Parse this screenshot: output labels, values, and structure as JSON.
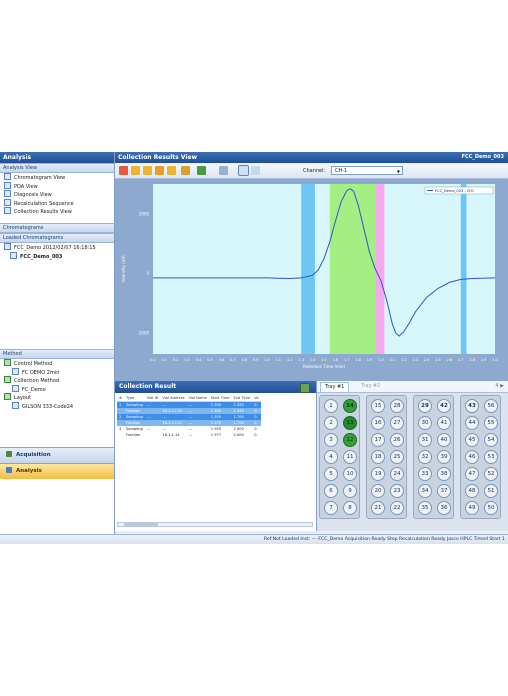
{
  "left_panel": {
    "title": "Analysis",
    "analysis_view": {
      "header": "Analysis View",
      "items": [
        "Chromatogram View",
        "PDA View",
        "Diagnosis View",
        "Recalculation Sequence",
        "Collection Results View"
      ]
    },
    "chromatograms": {
      "header": "Chromatograms"
    },
    "loaded": {
      "header": "Loaded Chromatograms",
      "items": [
        "FCC_Demo 2012/02/07 16:18:15",
        "FCC_Demo_003"
      ]
    },
    "method": {
      "header": "Method",
      "items": [
        "Control Method",
        "FC DEMO 2min",
        "Collection Method",
        "FC_Demo",
        "Layout",
        "GILSON 333-Code24"
      ]
    },
    "nav": {
      "acquisition": "Acquisition",
      "analysis": "Analysis"
    }
  },
  "main": {
    "title": "Collection Results View",
    "title_right": "FCC_Demo_003",
    "channel_label": "Channel:",
    "channel_value": "CH-1",
    "toolbar_icons": [
      "open-icon",
      "chart-icon",
      "chart-icon",
      "chart-icon",
      "chart-icon",
      "print-icon",
      "export-icon",
      "cursor-icon",
      "zoom-icon",
      "grid-icon"
    ]
  },
  "chart_data": {
    "type": "line",
    "xlabel": "Retention Time (min)",
    "ylabel": "Intensity (uV)",
    "x_ticks": [
      "0.0",
      "0.1",
      "0.2",
      "0.3",
      "0.4",
      "0.5",
      "0.6",
      "0.7",
      "0.8",
      "0.9",
      "1.0",
      "1.1",
      "1.2",
      "1.3",
      "1.4",
      "1.5",
      "1.6",
      "1.7",
      "1.8",
      "1.9",
      "2.0",
      "2.1",
      "2.2",
      "2.3",
      "2.4",
      "2.5",
      "2.6",
      "2.7",
      "2.8",
      "2.9",
      "3.0"
    ],
    "y_ticks": [
      "2000",
      "0",
      "-2000"
    ],
    "xlim": [
      0,
      3.0
    ],
    "ylim": [
      -2700,
      3000
    ],
    "legend": "FCC_Demo_003 : CH1",
    "series": [
      {
        "name": "FCC_Demo_003 : CH1",
        "color": "#2f55c8",
        "points": [
          [
            0.0,
            -150
          ],
          [
            0.5,
            -150
          ],
          [
            1.0,
            -150
          ],
          [
            1.1,
            -160
          ],
          [
            1.2,
            -170
          ],
          [
            1.3,
            -150
          ],
          [
            1.4,
            -60
          ],
          [
            1.45,
            120
          ],
          [
            1.5,
            500
          ],
          [
            1.55,
            1050
          ],
          [
            1.6,
            1750
          ],
          [
            1.65,
            2400
          ],
          [
            1.7,
            2780
          ],
          [
            1.73,
            2840
          ],
          [
            1.76,
            2760
          ],
          [
            1.8,
            2300
          ],
          [
            1.85,
            1500
          ],
          [
            1.9,
            700
          ],
          [
            1.95,
            150
          ],
          [
            2.0,
            -250
          ],
          [
            2.05,
            -900
          ],
          [
            2.1,
            -1700
          ],
          [
            2.13,
            -2000
          ],
          [
            2.16,
            -2100
          ],
          [
            2.2,
            -1950
          ],
          [
            2.25,
            -1650
          ],
          [
            2.3,
            -1300
          ],
          [
            2.4,
            -800
          ],
          [
            2.5,
            -500
          ],
          [
            2.6,
            -300
          ],
          [
            2.7,
            -200
          ],
          [
            2.8,
            -170
          ],
          [
            3.0,
            -150
          ]
        ]
      }
    ],
    "fraction_bands": [
      {
        "x0": 1.3,
        "x1": 1.42,
        "color": "#6ec6f2"
      },
      {
        "x0": 1.55,
        "x1": 1.95,
        "color": "#a4ef84"
      },
      {
        "x0": 1.95,
        "x1": 2.03,
        "color": "#f4a8ee"
      },
      {
        "x0": 2.7,
        "x1": 2.75,
        "color": "#6ec6f2"
      }
    ],
    "colors": {
      "plot_bg": "#d8f7fb",
      "frame": "#8ea9cf"
    }
  },
  "collection": {
    "title": "Collection Result",
    "columns": [
      "#",
      "Type",
      "Vial ID",
      "Vial Address",
      "Vial Name",
      "Start Time",
      "End Time",
      "Vo"
    ],
    "rows": [
      {
        "num": "1",
        "type": "Sampling",
        "vial_id": "---",
        "address": "---",
        "name": "---",
        "start": "1.300",
        "end": "1.350",
        "vo": "0.",
        "style": "hl"
      },
      {
        "num": "",
        "type": "Fraction",
        "vial_id": "",
        "address": "1K-1-11-33",
        "name": "---",
        "start": "1.300",
        "end": "1.350",
        "vo": "0.",
        "style": "hl2"
      },
      {
        "num": "2",
        "type": "Sampling",
        "vial_id": "---",
        "address": "---",
        "name": "---",
        "start": "1.350",
        "end": "1.700",
        "vo": "0.",
        "style": "hl"
      },
      {
        "num": "",
        "type": "Fraction",
        "vial_id": "",
        "address": "1K-1-11-12",
        "name": "---",
        "start": "1.370",
        "end": "1.700",
        "vo": "0.",
        "style": "hl2"
      },
      {
        "num": "3",
        "type": "Sampling",
        "vial_id": "---",
        "address": "---",
        "name": "---",
        "start": "1.955",
        "end": "2.000",
        "vo": "0.",
        "style": ""
      },
      {
        "num": "",
        "type": "Fraction",
        "vial_id": "",
        "address": "1K-1-1-14",
        "name": "---",
        "start": "1.977",
        "end": "2.000",
        "vo": "0.",
        "style": ""
      }
    ]
  },
  "tray": {
    "tabs": [
      "Tray #1",
      "Tray #2"
    ],
    "nav": "4 ▶",
    "columns": [
      [
        "1",
        "2",
        "3",
        "4",
        "5",
        "6",
        "7"
      ],
      [
        "14",
        "13",
        "12",
        "11",
        "10",
        "9",
        "8"
      ],
      [
        "15",
        "16",
        "17",
        "18",
        "19",
        "20",
        "21"
      ],
      [
        "28",
        "27",
        "26",
        "25",
        "24",
        "23",
        "22"
      ],
      [
        "29",
        "30",
        "31",
        "32",
        "33",
        "34",
        "35"
      ],
      [
        "42",
        "41",
        "40",
        "39",
        "38",
        "37",
        "36"
      ],
      [
        "43",
        "44",
        "45",
        "46",
        "47",
        "48",
        "49"
      ],
      [
        "56",
        "55",
        "54",
        "53",
        "52",
        "51",
        "50"
      ]
    ],
    "filled": [
      "14",
      "13",
      "12"
    ]
  },
  "status_bar": "Ref:Not Loaded  Inst: ---  FCC_Demo  Acquisition Ready  Stop  Recalculation Ready  Jasco HPLC  Timed Start 1"
}
